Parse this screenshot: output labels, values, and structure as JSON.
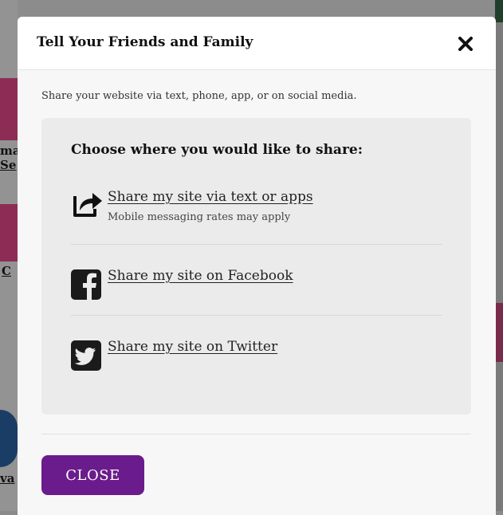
{
  "modal": {
    "title": "Tell Your Friends and Family",
    "intro": "Share your website via text, phone, app, or on social media.",
    "panel_heading": "Choose where you would like to share:",
    "options": [
      {
        "label": "Share my site via text or apps",
        "sub": "Mobile messaging rates may apply",
        "icon": "share-arrow-icon"
      },
      {
        "label": "Share my site on Facebook",
        "icon": "facebook-icon"
      },
      {
        "label": "Share my site on Twitter",
        "icon": "twitter-icon"
      }
    ],
    "close_label": "CLOSE"
  },
  "background": {
    "fragments": [
      "ma",
      "Se",
      "C",
      "va"
    ]
  },
  "colors": {
    "accent": "#6a1c8c",
    "panel": "#ebebeb",
    "overlay": "#8c8c8c",
    "background_tile_pink": "#b0446e",
    "background_tile_green": "#1e4a2e"
  }
}
